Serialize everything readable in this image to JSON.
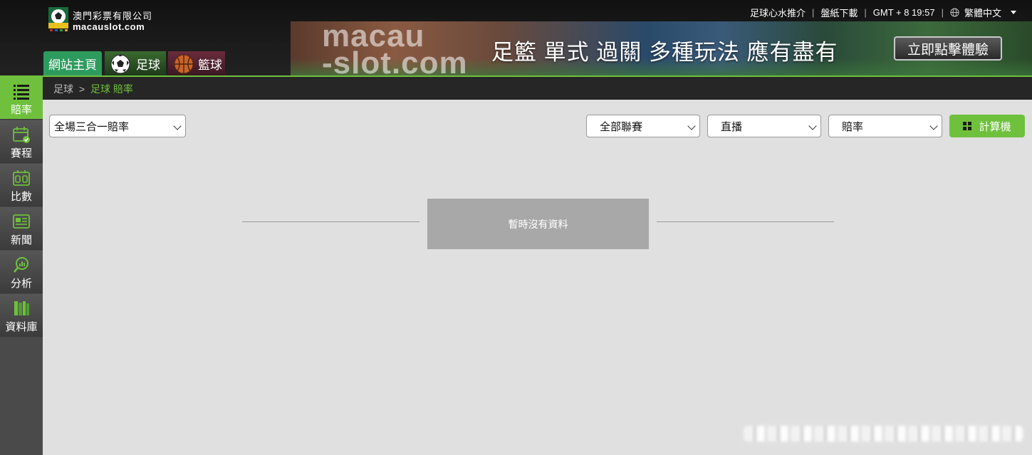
{
  "header": {
    "logo": {
      "cn": "澳門彩票有限公司",
      "en": "macauslot.com"
    },
    "topbar": {
      "links": [
        "足球心水推介",
        "盤紙下載"
      ],
      "clock": "GMT + 8 19:57",
      "language": "繁體中文"
    },
    "nav": {
      "home": "網站主頁",
      "football": "足球",
      "basketball": "籃球"
    },
    "banner": {
      "brand_line1": "macau",
      "brand_line2": "-slot.com",
      "slogan": "足籃 單式 過關    多種玩法 應有盡有",
      "cta": "立即點擊體驗"
    }
  },
  "sidebar": {
    "items": [
      {
        "label": "賠率",
        "icon": "list-icon",
        "active": true
      },
      {
        "label": "賽程",
        "icon": "calendar-check-icon",
        "active": false
      },
      {
        "label": "比數",
        "icon": "scoreboard-icon",
        "active": false
      },
      {
        "label": "新聞",
        "icon": "newspaper-icon",
        "active": false
      },
      {
        "label": "分析",
        "icon": "analysis-magnifier-icon",
        "active": false
      },
      {
        "label": "資料庫",
        "icon": "books-icon",
        "active": false
      }
    ]
  },
  "breadcrumb": {
    "root": "足球",
    "separator": ">",
    "current": "足球 賠率"
  },
  "filters": {
    "market": "全場三合一賠率",
    "league": "全部聯賽",
    "live": "直播",
    "odds": "賠率",
    "calculator": "計算機"
  },
  "empty_state": {
    "message": "暫時沒有資料"
  },
  "colors": {
    "accent": "#6fc03c",
    "home_tab": "#2e9b5e",
    "header_bg": "#1c1c1c",
    "page_bg": "#e0e0e0"
  }
}
